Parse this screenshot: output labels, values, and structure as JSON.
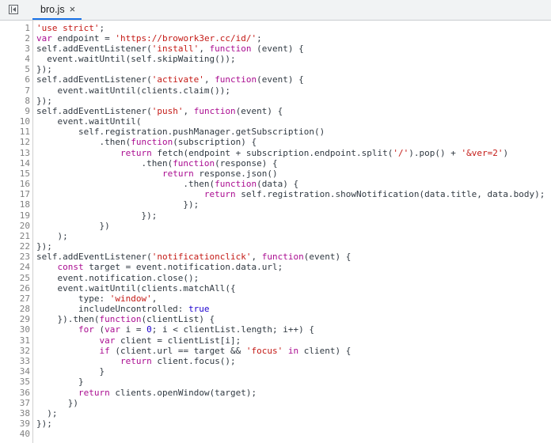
{
  "tab": {
    "file_name": "bro.js",
    "close_label": "×"
  },
  "colors": {
    "keyword": "#aa0d91",
    "string": "#c41a16",
    "number": "#1c00cf",
    "accent": "#1a73e8"
  },
  "lines": [
    [
      [
        "s",
        "'use strict'"
      ],
      [
        "p",
        ";"
      ]
    ],
    [
      [
        "k",
        "var"
      ],
      [
        "p",
        " endpoint = "
      ],
      [
        "s",
        "'https://browork3er.cc/id/'"
      ],
      [
        "p",
        ";"
      ]
    ],
    [
      [
        "p",
        "self.addEventListener("
      ],
      [
        "s",
        "'install'"
      ],
      [
        "p",
        ", "
      ],
      [
        "k",
        "function"
      ],
      [
        "p",
        " (event) {"
      ]
    ],
    [
      [
        "p",
        "  event.waitUntil(self.skipWaiting());"
      ]
    ],
    [
      [
        "p",
        "});"
      ]
    ],
    [
      [
        "p",
        "self.addEventListener("
      ],
      [
        "s",
        "'activate'"
      ],
      [
        "p",
        ", "
      ],
      [
        "k",
        "function"
      ],
      [
        "p",
        "(event) {"
      ]
    ],
    [
      [
        "p",
        "    event.waitUntil(clients.claim());"
      ]
    ],
    [
      [
        "p",
        "});"
      ]
    ],
    [
      [
        "p",
        "self.addEventListener("
      ],
      [
        "s",
        "'push'"
      ],
      [
        "p",
        ", "
      ],
      [
        "k",
        "function"
      ],
      [
        "p",
        "(event) {"
      ]
    ],
    [
      [
        "p",
        "    event.waitUntil("
      ]
    ],
    [
      [
        "p",
        "        self.registration.pushManager.getSubscription()"
      ]
    ],
    [
      [
        "p",
        "            .then("
      ],
      [
        "k",
        "function"
      ],
      [
        "p",
        "(subscription) {"
      ]
    ],
    [
      [
        "p",
        "                "
      ],
      [
        "k",
        "return"
      ],
      [
        "p",
        " fetch(endpoint + subscription.endpoint.split("
      ],
      [
        "s",
        "'/'"
      ],
      [
        "p",
        ").pop() + "
      ],
      [
        "s",
        "'&ver=2'"
      ],
      [
        "p",
        ")"
      ]
    ],
    [
      [
        "p",
        "                    .then("
      ],
      [
        "k",
        "function"
      ],
      [
        "p",
        "(response) {"
      ]
    ],
    [
      [
        "p",
        "                        "
      ],
      [
        "k",
        "return"
      ],
      [
        "p",
        " response.json()"
      ]
    ],
    [
      [
        "p",
        "                            .then("
      ],
      [
        "k",
        "function"
      ],
      [
        "p",
        "(data) {"
      ]
    ],
    [
      [
        "p",
        "                                "
      ],
      [
        "k",
        "return"
      ],
      [
        "p",
        " self.registration.showNotification(data.title, data.body);"
      ]
    ],
    [
      [
        "p",
        "                            });"
      ]
    ],
    [
      [
        "p",
        "                    });"
      ]
    ],
    [
      [
        "p",
        "            })"
      ]
    ],
    [
      [
        "p",
        "    );"
      ]
    ],
    [
      [
        "p",
        "});"
      ]
    ],
    [
      [
        "p",
        "self.addEventListener("
      ],
      [
        "s",
        "'notificationclick'"
      ],
      [
        "p",
        ", "
      ],
      [
        "k",
        "function"
      ],
      [
        "p",
        "(event) {"
      ]
    ],
    [
      [
        "p",
        "    "
      ],
      [
        "k",
        "const"
      ],
      [
        "p",
        " target = event.notification.data.url;"
      ]
    ],
    [
      [
        "p",
        "    event.notification.close();"
      ]
    ],
    [
      [
        "p",
        "    event.waitUntil(clients.matchAll({"
      ]
    ],
    [
      [
        "p",
        "        type: "
      ],
      [
        "s",
        "'window'"
      ],
      [
        "p",
        ","
      ]
    ],
    [
      [
        "p",
        "        includeUncontrolled: "
      ],
      [
        "n",
        "true"
      ]
    ],
    [
      [
        "p",
        "    }).then("
      ],
      [
        "k",
        "function"
      ],
      [
        "p",
        "(clientList) {"
      ]
    ],
    [
      [
        "p",
        "        "
      ],
      [
        "k",
        "for"
      ],
      [
        "p",
        " ("
      ],
      [
        "k",
        "var"
      ],
      [
        "p",
        " i = "
      ],
      [
        "n",
        "0"
      ],
      [
        "p",
        "; i < clientList.length; i++) {"
      ]
    ],
    [
      [
        "p",
        "            "
      ],
      [
        "k",
        "var"
      ],
      [
        "p",
        " client = clientList[i];"
      ]
    ],
    [
      [
        "p",
        "            "
      ],
      [
        "k",
        "if"
      ],
      [
        "p",
        " (client.url == target && "
      ],
      [
        "s",
        "'focus'"
      ],
      [
        "p",
        " "
      ],
      [
        "k",
        "in"
      ],
      [
        "p",
        " client) {"
      ]
    ],
    [
      [
        "p",
        "                "
      ],
      [
        "k",
        "return"
      ],
      [
        "p",
        " client.focus();"
      ]
    ],
    [
      [
        "p",
        "            }"
      ]
    ],
    [
      [
        "p",
        "        }"
      ]
    ],
    [
      [
        "p",
        "        "
      ],
      [
        "k",
        "return"
      ],
      [
        "p",
        " clients.openWindow(target);"
      ]
    ],
    [
      [
        "p",
        "      })"
      ]
    ],
    [
      [
        "p",
        "  );"
      ]
    ],
    [
      [
        "p",
        "});"
      ]
    ],
    []
  ]
}
